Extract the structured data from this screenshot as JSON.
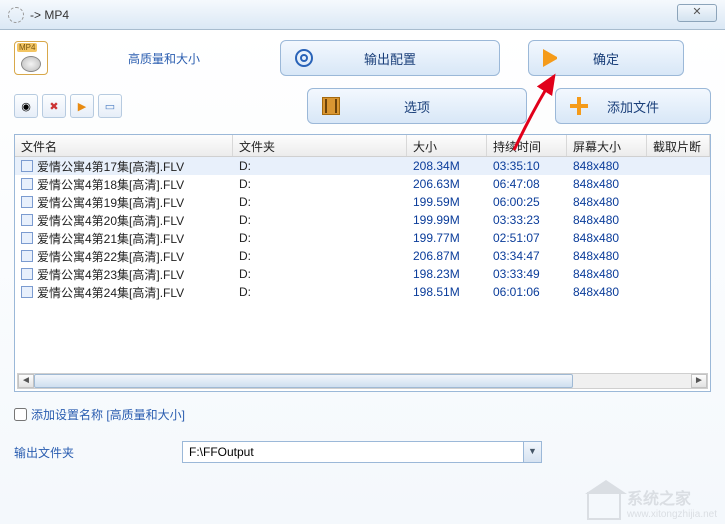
{
  "window": {
    "title": "-> MP4"
  },
  "top": {
    "quality_label": "高质量和大小",
    "output_config": "输出配置",
    "confirm": "确定",
    "options": "选项",
    "add_file": "添加文件"
  },
  "columns": {
    "filename": "文件名",
    "folder": "文件夹",
    "size": "大小",
    "duration": "持续时间",
    "screen": "屏幕大小",
    "clip": "截取片断"
  },
  "rows": [
    {
      "name": "爱情公寓4第17集[高清].FLV",
      "folder": "D:",
      "size": "208.34M",
      "dur": "03:35:10",
      "res": "848x480",
      "sel": true
    },
    {
      "name": "爱情公寓4第18集[高清].FLV",
      "folder": "D:",
      "size": "206.63M",
      "dur": "06:47:08",
      "res": "848x480",
      "sel": false
    },
    {
      "name": "爱情公寓4第19集[高清].FLV",
      "folder": "D:",
      "size": "199.59M",
      "dur": "06:00:25",
      "res": "848x480",
      "sel": false
    },
    {
      "name": "爱情公寓4第20集[高清].FLV",
      "folder": "D:",
      "size": "199.99M",
      "dur": "03:33:23",
      "res": "848x480",
      "sel": false
    },
    {
      "name": "爱情公寓4第21集[高清].FLV",
      "folder": "D:",
      "size": "199.77M",
      "dur": "02:51:07",
      "res": "848x480",
      "sel": false
    },
    {
      "name": "爱情公寓4第22集[高清].FLV",
      "folder": "D:",
      "size": "206.87M",
      "dur": "03:34:47",
      "res": "848x480",
      "sel": false
    },
    {
      "name": "爱情公寓4第23集[高清].FLV",
      "folder": "D:",
      "size": "198.23M",
      "dur": "03:33:49",
      "res": "848x480",
      "sel": false
    },
    {
      "name": "爱情公寓4第24集[高清].FLV",
      "folder": "D:",
      "size": "198.51M",
      "dur": "06:01:06",
      "res": "848x480",
      "sel": false
    }
  ],
  "checkbox": {
    "label": "添加设置名称 [高质量和大小]"
  },
  "output": {
    "label": "输出文件夹",
    "value": "F:\\FFOutput"
  },
  "watermark": {
    "line1": "系统之家",
    "line2": "www.xitongzhijia.net"
  }
}
